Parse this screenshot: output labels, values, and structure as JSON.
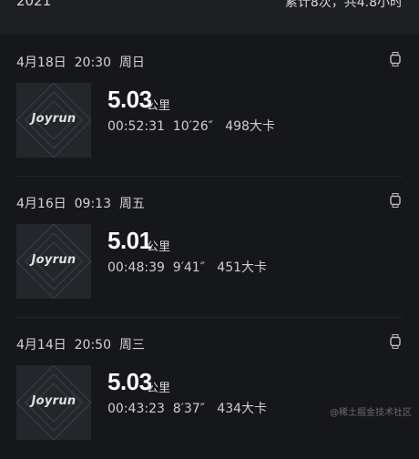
{
  "header": {
    "year": "2021",
    "summary": "累计8次，共4.8小时"
  },
  "records": [
    {
      "date": "4月18日",
      "time": "20:30",
      "weekday": "周日",
      "thumb_label": "Joyrun",
      "distance": "5.03",
      "unit": "公里",
      "duration": "00:52:31",
      "pace": "10′26″",
      "calories": "498大卡"
    },
    {
      "date": "4月16日",
      "time": "09:13",
      "weekday": "周五",
      "thumb_label": "Joyrun",
      "distance": "5.01",
      "unit": "公里",
      "duration": "00:48:39",
      "pace": "9′41″",
      "calories": "451大卡"
    },
    {
      "date": "4月14日",
      "time": "20:50",
      "weekday": "周三",
      "thumb_label": "Joyrun",
      "distance": "5.03",
      "unit": "公里",
      "duration": "00:43:23",
      "pace": "8′37″",
      "calories": "434大卡"
    }
  ],
  "watermark": "@稀土掘金技术社区",
  "icons": {
    "device": "watch-icon"
  }
}
